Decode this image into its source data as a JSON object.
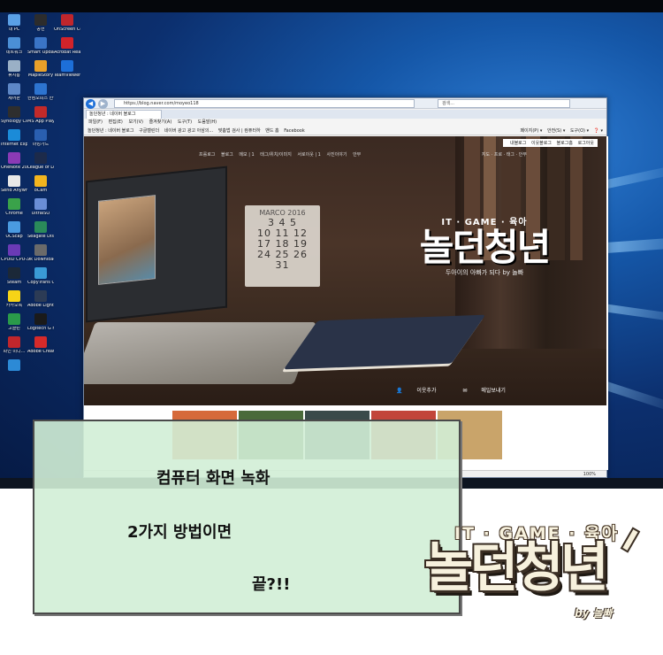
{
  "desktop_icons": [
    {
      "label": "내 PC",
      "color": "#5aa0e6"
    },
    {
      "label": "공헌",
      "color": "#2c2c2c"
    },
    {
      "label": "OnScreen Control",
      "color": "#c0262c"
    },
    {
      "label": "네트워크",
      "color": "#4b8fd6"
    },
    {
      "label": "Smart Updater Plus",
      "color": "#3a74c6"
    },
    {
      "label": "Acrobat Reader DC",
      "color": "#d2232a"
    },
    {
      "label": "휴지통",
      "color": "#9ab0c6"
    },
    {
      "label": "MapleStory",
      "color": "#e8a02a"
    },
    {
      "label": "TeamViewer 14",
      "color": "#1d6fd8"
    },
    {
      "label": "제어판",
      "color": "#5d87c6"
    },
    {
      "label": "한컴오피스 한글 201...",
      "color": "#2d74cf"
    },
    {
      "label": "Synology Cloud ...",
      "color": "#2e2e2e"
    },
    {
      "label": "MS App Player",
      "color": "#c22a2a"
    },
    {
      "label": "Internet Explorer",
      "color": "#1b8bd8"
    },
    {
      "label": "마킹가드",
      "color": "#2a5fb0"
    },
    {
      "label": "OneNote 2013",
      "color": "#8a3ab5"
    },
    {
      "label": "League of Legends",
      "color": "#1c2a4a"
    },
    {
      "label": "Send Anywhere",
      "color": "#e8e8e8"
    },
    {
      "label": "oCam",
      "color": "#f3b51e"
    },
    {
      "label": "Chrome",
      "color": "#3aa24a"
    },
    {
      "label": "UltraISO",
      "color": "#6a8ed6"
    },
    {
      "label": "UCScap",
      "color": "#4a9ae0"
    },
    {
      "label": "Seagate DiscWizard",
      "color": "#2a8a5a"
    },
    {
      "label": "CPUID CPU-Z",
      "color": "#6a3ab5"
    },
    {
      "label": "9k Downloader",
      "color": "#6a6a6a"
    },
    {
      "label": "Steam",
      "color": "#1b2838"
    },
    {
      "label": "CopyTrans Control ...",
      "color": "#3a9ad6"
    },
    {
      "label": "카카오톡",
      "color": "#f7d417"
    },
    {
      "label": "Adobe Lightroo...",
      "color": "#2c3b55"
    },
    {
      "label": "고클린",
      "color": "#2a9a4a"
    },
    {
      "label": "Logitech G HUB",
      "color": "#1a1a1a"
    },
    {
      "label": "파인 미디...",
      "color": "#c0262c"
    },
    {
      "label": "Adobe Creative ...",
      "color": "#d62a2a"
    },
    {
      "label": "",
      "color": "#2c8ad6"
    }
  ],
  "browser": {
    "url": "https://blog.naver.com/moyeo118",
    "search_placeholder": "검색...",
    "tab_title": "놀던청년 : 네이버 블로그",
    "menu": [
      "파일(F)",
      "편집(E)",
      "보기(V)",
      "즐겨찾기(A)",
      "도구(T)",
      "도움말(H)"
    ],
    "favorites": [
      "놀던청년 : 네이버 블로그",
      "구글캘린더",
      "네이버 광고 광고 아삼의...",
      "맞춤법 검사 | 컴퓨터하",
      "밴드 홈",
      "Facebook"
    ],
    "commands": [
      "페이지(P) ▾",
      "안전(S) ▾",
      "도구(O) ▾",
      "❓ ▾"
    ],
    "status_zoom": "100%"
  },
  "blog": {
    "nav_links": [
      "프롤로그",
      "블로그",
      "메모 | 1",
      "태그/위치/이미지",
      "서로이웃 | 1",
      "사진이야기",
      "안부"
    ],
    "top_nav": [
      "내블로그",
      "이웃블로그",
      "블로그홈",
      "로그아웃"
    ],
    "sub_nav": [
      "지도 · 프로 · 태그 · 안부"
    ],
    "calendar_title": "MARCO 2016",
    "calendar_rows": [
      "3  4  5",
      "10 11 12",
      "17 18 19",
      "24 25 26",
      "31"
    ],
    "logo_tag": "IT · GAME · 육아",
    "logo_name": "놀던청년",
    "logo_sub": "두아이의 아빠가 되다  by 놀빠",
    "action_add_neighbor": "이웃추가",
    "action_mail": "메일보내기",
    "thumbnail_colors": [
      "#d66a3a",
      "#4a6a3a",
      "#3a4a4a",
      "#c2453a",
      "#c9a46a"
    ]
  },
  "caption": {
    "line1": "컴퓨터 화면 녹화",
    "line2": "2가지 방법이면",
    "line3": "끝?!!"
  },
  "brand_logo": {
    "tag": "IT · GAME · 육아",
    "name": "놀던청년",
    "by": "by 놀빠"
  }
}
